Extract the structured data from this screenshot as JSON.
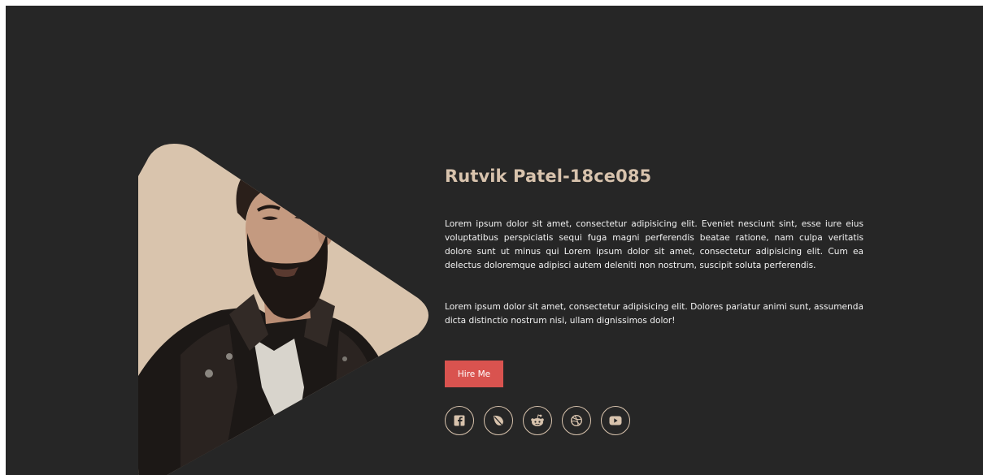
{
  "profile": {
    "name": "Rutvik Patel-18ce085",
    "paragraph1": "Lorem ipsum dolor sit amet, consectetur adipisicing elit. Eveniet nesciunt sint, esse iure eius voluptatibus perspiciatis sequi fuga magni perferendis beatae ratione, nam culpa veritatis dolore sunt ut minus qui Lorem ipsum dolor sit amet, consectetur adipisicing elit. Cum ea delectus doloremque adipisci autem deleniti non nostrum, suscipit soluta perferendis.",
    "paragraph2": "Lorem ipsum dolor sit amet, consectetur adipisicing elit. Dolores pariatur animi sunt, assumenda dicta distinctio nostrum nisi, ullam dignissimos dolor!",
    "hire_label": "Hire Me"
  },
  "social": [
    {
      "icon": "facebook-icon"
    },
    {
      "icon": "leaf-icon"
    },
    {
      "icon": "reddit-icon"
    },
    {
      "icon": "dribbble-icon"
    },
    {
      "icon": "youtube-icon"
    }
  ],
  "colors": {
    "background": "#262626",
    "accent": "#d8c3ad",
    "button": "#d9534f",
    "text": "#f2f2f2"
  }
}
